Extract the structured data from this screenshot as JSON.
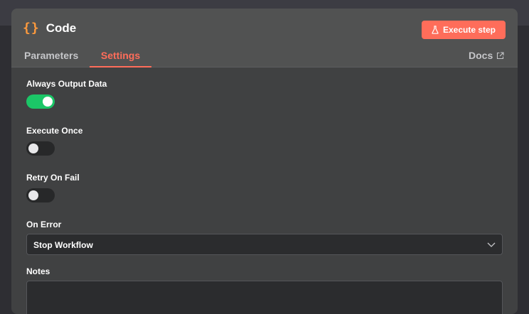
{
  "node": {
    "icon": "curly-braces-icon",
    "icon_text": "{}",
    "title": "Code",
    "execute_button_label": "Execute step"
  },
  "tabs": [
    {
      "label": "Parameters",
      "active": false
    },
    {
      "label": "Settings",
      "active": true
    }
  ],
  "docs_label": "Docs",
  "settings": {
    "always_output_data": {
      "label": "Always Output Data",
      "enabled": true
    },
    "execute_once": {
      "label": "Execute Once",
      "enabled": false
    },
    "retry_on_fail": {
      "label": "Retry On Fail",
      "enabled": false
    },
    "on_error": {
      "label": "On Error",
      "value": "Stop Workflow"
    },
    "notes": {
      "label": "Notes",
      "value": ""
    }
  },
  "colors": {
    "accent": "#ff6d5a",
    "toggle_on": "#1bc667",
    "code_icon": "#ff9b3d"
  }
}
